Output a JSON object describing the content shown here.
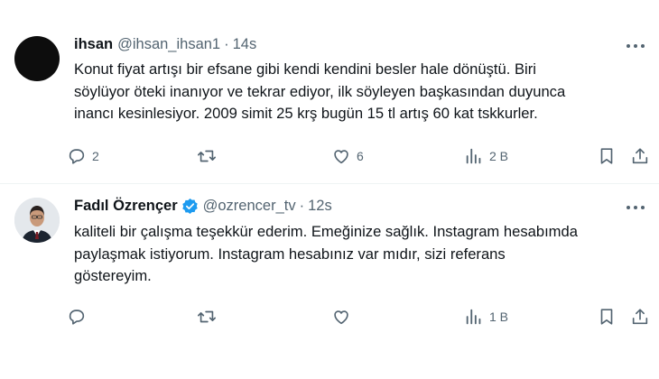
{
  "tweets": [
    {
      "name": "ihsan",
      "handle": "@ihsan_ihsan1",
      "dot": "·",
      "time": "14s",
      "lines": [
        "Konut fiyat artışı bir efsane gibi kendi kendini besler hale dönüştü.  Biri",
        "söylüyor öteki inanıyor ve tekrar ediyor, ilk söyleyen başkasından duyunca",
        "inancı kesinlesiyor. 2009 simit 25 krş bugün 15 tl artış 60 kat tskkurler."
      ],
      "replies": "2",
      "retweets": "",
      "likes": "6",
      "views": "2 B",
      "verified": false
    },
    {
      "name": "Fadıl Özrençer",
      "handle": "@ozrencer_tv",
      "dot": "·",
      "time": "12s",
      "lines": [
        "kaliteli bir çalışma teşekkür ederim. Emeğinize sağlık. Instagram hesabımda",
        "paylaşmak istiyorum. Instagram hesabınız var mıdır, sizi referans",
        "göstereyim."
      ],
      "replies": "",
      "retweets": "",
      "likes": "",
      "views": "1 B",
      "verified": true
    }
  ],
  "colors": {
    "text": "#0f1419",
    "muted": "#536471",
    "verified": "#1d9bf0",
    "divider": "#eff3f4"
  },
  "icons": [
    "more-icon",
    "reply-icon",
    "retweet-icon",
    "like-icon",
    "views-icon",
    "bookmark-icon",
    "share-icon",
    "verified-badge-icon"
  ]
}
